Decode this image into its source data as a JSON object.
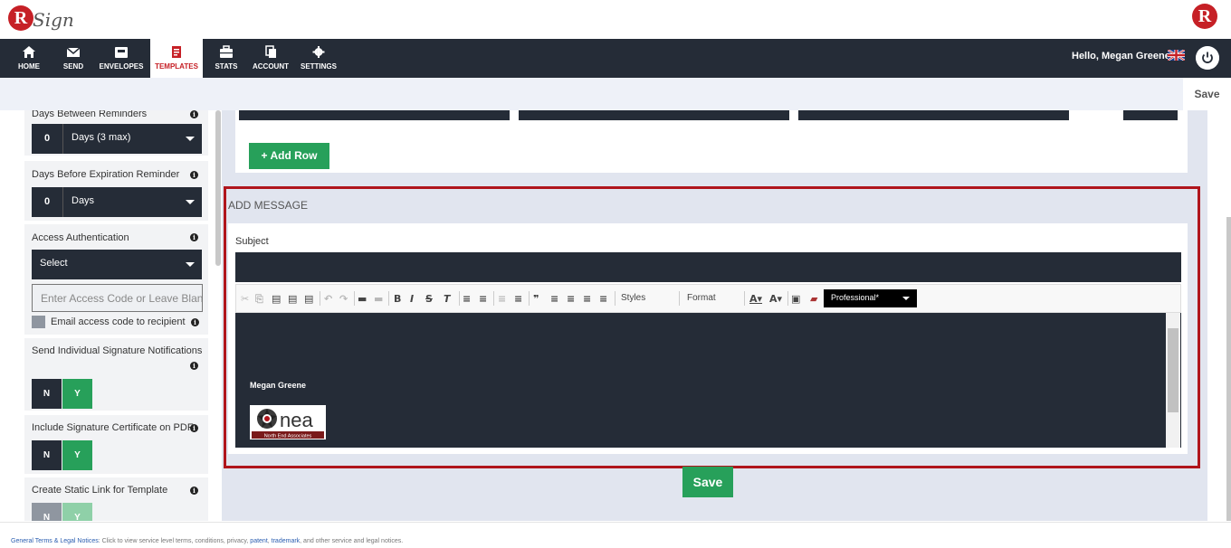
{
  "brand": {
    "logo_letter": "R",
    "logo_word": "Sign",
    "accent": "#c62026",
    "dark": "#252c37",
    "green": "#27a05a"
  },
  "nav": {
    "items": [
      {
        "label": "HOME",
        "icon": "home-icon"
      },
      {
        "label": "SEND",
        "icon": "envelope-icon"
      },
      {
        "label": "ENVELOPES",
        "icon": "inbox-icon"
      },
      {
        "label": "TEMPLATES",
        "icon": "document-icon",
        "active": true
      },
      {
        "label": "STATS",
        "icon": "briefcase-icon"
      },
      {
        "label": "ACCOUNT",
        "icon": "copy-icon"
      },
      {
        "label": "SETTINGS",
        "icon": "gear-icon"
      }
    ],
    "greeting": "Hello, Megan Greene"
  },
  "subbar": {
    "save_label": "Save"
  },
  "settings": {
    "days_between_reminders": {
      "label": "Days Between Reminders",
      "value": "0",
      "unit": "Days (3 max)"
    },
    "days_before_expiration": {
      "label": "Days Before Expiration Reminder",
      "value": "0",
      "unit": "Days"
    },
    "access_authentication": {
      "label": "Access Authentication",
      "selected": "Select",
      "placeholder": "Enter Access Code or Leave Blank",
      "email_code_label": "Email access code to recipient"
    },
    "individual_notifications": {
      "label": "Send Individual Signature Notifications",
      "no": "N",
      "yes": "Y"
    },
    "signature_certificate": {
      "label": "Include Signature Certificate on PDF",
      "no": "N",
      "yes": "Y"
    },
    "static_link": {
      "label": "Create Static Link for Template",
      "no": "N",
      "yes": "Y"
    }
  },
  "recipients": {
    "add_row_label": "+ Add Row"
  },
  "message": {
    "section_title": "ADD MESSAGE",
    "subject_label": "Subject",
    "subject_value": "",
    "toolbar": {
      "styles_label": "Styles",
      "format_label": "Format",
      "template_selected": "Professional*"
    },
    "signature_name": "Megan Greene",
    "signature_company": "North End Associates",
    "signature_logo_text": "nea"
  },
  "save_label": "Save",
  "footer": {
    "prefix": "General Terms & Legal Notices",
    "text": ": Click to view service level terms, conditions, privacy, ",
    "patent": "patent",
    "trademark": "trademark",
    "suffix": ", and other service and legal notices."
  }
}
